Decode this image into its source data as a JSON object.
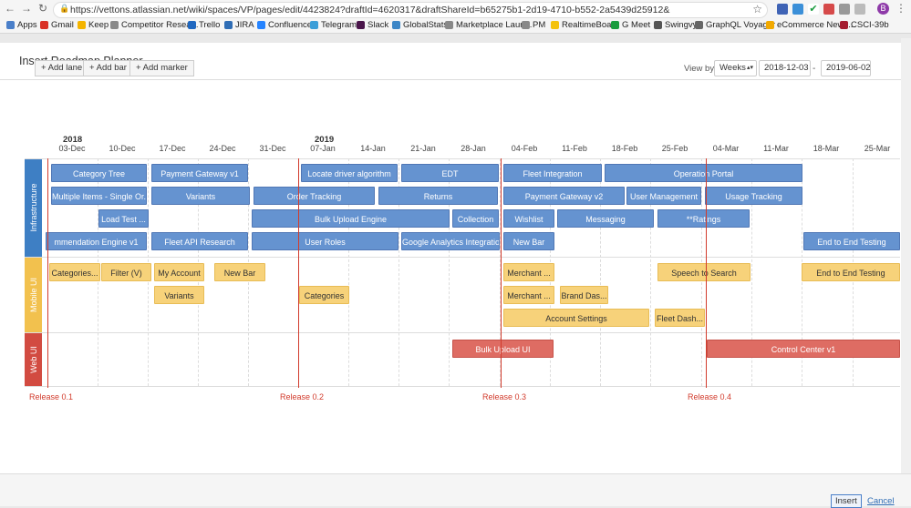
{
  "browser": {
    "url": "https://vettons.atlassian.net/wiki/spaces/VP/pages/edit/4423824?draftId=4620317&draftShareId=b65275b1-2d19-4710-b552-2a5439d25912&",
    "profile_initial": "B",
    "bookmarks": [
      "Apps",
      "Gmail",
      "Keep",
      "Competitor Resea...",
      "Trello",
      "JIRA",
      "Confluence",
      "Telegram",
      "Slack",
      "GlobalStats",
      "Marketplace Laun...",
      "PM",
      "RealtimeBoard",
      "G Meet",
      "Swingvy",
      "GraphQL Voyager",
      "eCommerce News...",
      "CSCI-39b"
    ]
  },
  "dialog": {
    "title": "Insert Roadmap Planner",
    "toolbar": {
      "add_lane": "+ Add lane",
      "add_bar": "+ Add bar",
      "add_marker": "+ Add marker"
    },
    "view_by_label": "View by",
    "view_by_value": "Weeks",
    "start_date": "2018-12-03",
    "date_separator": "-",
    "end_date": "2019-06-02",
    "insert_label": "Insert",
    "cancel_label": "Cancel"
  },
  "timeline": {
    "years": [
      "2018",
      "2019"
    ],
    "weeks": [
      "03-Dec",
      "10-Dec",
      "17-Dec",
      "24-Dec",
      "31-Dec",
      "07-Jan",
      "14-Jan",
      "21-Jan",
      "28-Jan",
      "04-Feb",
      "11-Feb",
      "18-Feb",
      "25-Feb",
      "04-Mar",
      "11-Mar",
      "18-Mar",
      "25-Mar"
    ]
  },
  "lanes": [
    {
      "name": "Infrastructure",
      "color": "#3e7fc4"
    },
    {
      "name": "Mobile UI",
      "color": "#f2c14e"
    },
    {
      "name": "Web UI",
      "color": "#d24b41"
    }
  ],
  "bars": {
    "infrastructure": [
      "Category Tree",
      "Payment Gateway v1",
      "Locate driver algorithm",
      "EDT",
      "Fleet Integration",
      "Operation Portal",
      "Multiple Items - Single Or...",
      "Variants",
      "Order Tracking",
      "Returns",
      "Payment Gateway v2",
      "User Management",
      "Usage Tracking",
      "Load Test ...",
      "Bulk Upload Engine",
      "Collection",
      "Wishlist",
      "Messaging",
      "**Ratings",
      "mmendation Engine v1",
      "Fleet API Research",
      "User Roles",
      "Google Analytics Integration",
      "New Bar",
      "End to End Testing"
    ],
    "mobile": [
      "Categories...",
      "Filter (V)",
      "My Account",
      "New Bar",
      "Merchant ...",
      "Speech to Search",
      "End to End Testing",
      "Variants",
      "Categories",
      "Merchant ...",
      "Brand Das...",
      "Account Settings",
      "Fleet Dash..."
    ],
    "web": [
      "Bulk Upload UI",
      "Control Center v1"
    ]
  },
  "markers": [
    "Release 0.1",
    "Release 0.2",
    "Release 0.3",
    "Release 0.4"
  ],
  "colors": {
    "blue_bar": "#6593d0",
    "yellow_bar": "#f7d27a",
    "red_bar": "#de6c63",
    "marker": "#d23b2c"
  }
}
